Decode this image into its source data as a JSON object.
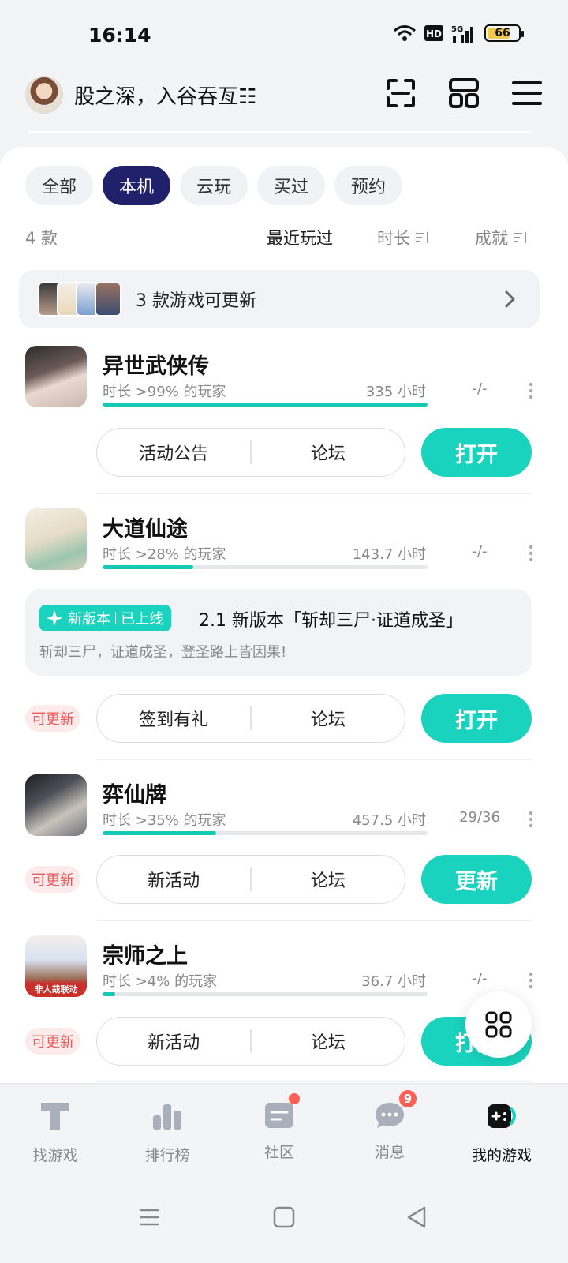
{
  "status_bar": {
    "time": "16:14",
    "battery": "66",
    "network": "5G",
    "hd": "HD"
  },
  "header": {
    "user_name": "股之深，入谷吞亙☷"
  },
  "filters": [
    {
      "label": "全部",
      "active": false
    },
    {
      "label": "本机",
      "active": true
    },
    {
      "label": "云玩",
      "active": false
    },
    {
      "label": "买过",
      "active": false
    },
    {
      "label": "预约",
      "active": false
    }
  ],
  "sort": {
    "count": "4 款",
    "recent": "最近玩过",
    "duration": "时长",
    "achievement": "成就"
  },
  "update_banner": {
    "text": "3 款游戏可更新"
  },
  "games": [
    {
      "title": "异世武侠传",
      "percentile": "时长 >99% 的玩家",
      "hours": "335 小时",
      "achievement": "-/-",
      "progress": 1.0,
      "left_button": "活动公告",
      "right_button": "论坛",
      "action": "打开"
    },
    {
      "title": "大道仙途",
      "percentile": "时长 >28% 的玩家",
      "hours": "143.7 小时",
      "achievement": "-/-",
      "progress": 0.28,
      "left_button": "签到有礼",
      "right_button": "论坛",
      "action": "打开",
      "update_tag": "可更新",
      "news": {
        "badge_new": "新版本",
        "badge_online": "已上线",
        "title": "2.1 新版本「斩却三尸·证道成圣」",
        "desc": "斩却三尸，证道成圣，登圣路上皆因果!"
      }
    },
    {
      "title": "弈仙牌",
      "percentile": "时长 >35% 的玩家",
      "hours": "457.5 小时",
      "achievement": "29/36",
      "progress": 0.35,
      "left_button": "新活动",
      "right_button": "论坛",
      "action": "更新",
      "update_tag": "可更新"
    },
    {
      "title": "宗师之上",
      "percentile": "时长 >4% 的玩家",
      "hours": "36.7 小时",
      "achievement": "-/-",
      "progress": 0.04,
      "left_button": "新活动",
      "right_button": "论坛",
      "action": "打开",
      "update_tag": "可更新",
      "icon_caption": "非人哉联动"
    }
  ],
  "bottom_nav": [
    {
      "label": "找游戏",
      "icon": "find-games-icon"
    },
    {
      "label": "排行榜",
      "icon": "ranking-icon"
    },
    {
      "label": "社区",
      "icon": "community-icon"
    },
    {
      "label": "消息",
      "icon": "message-icon",
      "badge": "9"
    },
    {
      "label": "我的游戏",
      "icon": "my-games-icon",
      "active": true
    }
  ],
  "colors": {
    "accent": "#19d3be",
    "active_chip": "#21206b",
    "update_tag": "#ec5a5a",
    "badge": "#ff5f55"
  }
}
